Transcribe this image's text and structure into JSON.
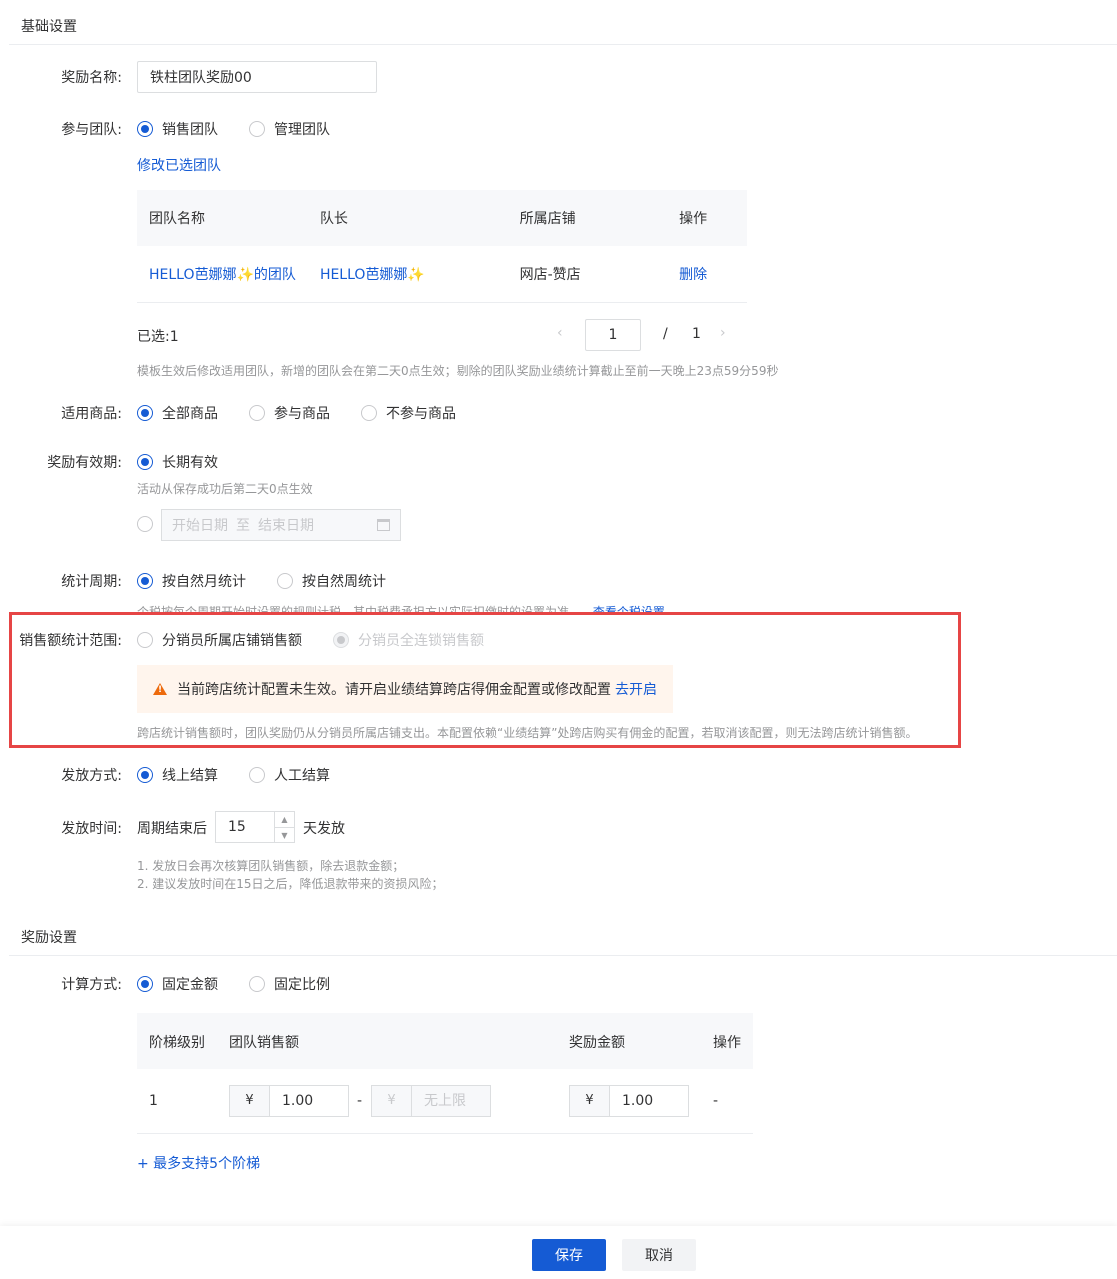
{
  "basic": {
    "section_title": "基础设置",
    "reward_name_label": "奖励名称:",
    "reward_name_value": "铁柱团队奖励00",
    "team_label": "参与团队:",
    "team_options": [
      "销售团队",
      "管理团队"
    ],
    "modify_team_link": "修改已选团队",
    "team_table": {
      "headers": [
        "团队名称",
        "队长",
        "所属店铺",
        "操作"
      ],
      "row": {
        "team_name": "HELLO芭娜娜✨的团队",
        "leader": "HELLO芭娜娜✨",
        "shop": "网店-赞店",
        "action": "删除"
      }
    },
    "selected_text": "已选:1",
    "pager": {
      "prev": "‹",
      "current": "1",
      "separator": "/",
      "total": "1",
      "next": "›"
    },
    "team_hint": "模板生效后修改适用团队，新增的团队会在第二天0点生效；剔除的团队奖励业绩统计算截止至前一天晚上23点59分59秒",
    "goods_label": "适用商品:",
    "goods_options": [
      "全部商品",
      "参与商品",
      "不参与商品"
    ],
    "validity_label": "奖励有效期:",
    "validity_option": "长期有效",
    "validity_hint": "活动从保存成功后第二天0点生效",
    "date_start_placeholder": "开始日期",
    "date_to": "至",
    "date_end_placeholder": "结束日期",
    "period_label": "统计周期:",
    "period_options": [
      "按自然月统计",
      "按自然周统计"
    ],
    "period_hint": "个税按每个周期开始时设置的规则计税，其中税费承担方以实际扣缴时的设置为准。",
    "period_hint_link": "查看个税设置",
    "scope_label": "销售额统计范围:",
    "scope_options": [
      "分销员所属店铺销售额",
      "分销员全连锁销售额"
    ],
    "warn_text": "当前跨店统计配置未生效。请开启业绩结算跨店得佣金配置或修改配置",
    "warn_link": "去开启",
    "scope_hint": "跨店统计销售额时，团队奖励仍从分销员所属店铺支出。本配置依赖“业绩结算”处跨店购买有佣金的配置，若取消该配置，则无法跨店统计销售额。",
    "pay_label": "发放方式:",
    "pay_options": [
      "线上结算",
      "人工结算"
    ],
    "time_label": "发放时间:",
    "time_prefix": "周期结束后",
    "time_value": "15",
    "time_suffix": "天发放",
    "time_hint_1": "1. 发放日会再次核算团队销售额，除去退款金额；",
    "time_hint_2": "2. 建议发放时间在15日之后，降低退款带来的资损风险；"
  },
  "reward": {
    "section_title": "奖励设置",
    "calc_label": "计算方式:",
    "calc_options": [
      "固定金额",
      "固定比例"
    ],
    "table": {
      "headers": [
        "阶梯级别",
        "团队销售额",
        "奖励金额",
        "操作"
      ],
      "row": {
        "level": "1",
        "currency": "¥",
        "sales_min": "1.00",
        "dash": "-",
        "sales_max_placeholder": "无上限",
        "reward": "1.00",
        "action": "-"
      }
    },
    "add_link": "+ 最多支持5个阶梯"
  },
  "footer": {
    "save": "保存",
    "cancel": "取消"
  },
  "colors": {
    "primary": "#155bd4",
    "warning": "#ed6a0c",
    "warning_bg": "#fff5ed",
    "highlight_frame": "#e64545"
  }
}
